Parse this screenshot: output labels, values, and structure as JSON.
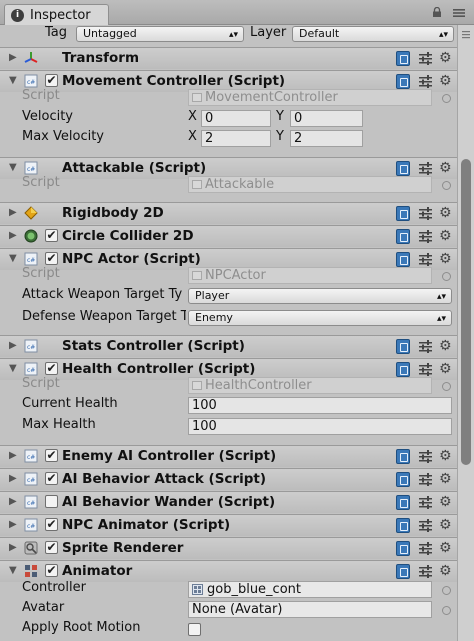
{
  "window": {
    "tab_label": "Inspector"
  },
  "topbar": {
    "tag_label": "Tag",
    "tag_value": "Untagged",
    "layer_label": "Layer",
    "layer_value": "Default"
  },
  "components": {
    "transform": {
      "title": "Transform"
    },
    "movement": {
      "title": "Movement Controller (Script)",
      "script_label": "Script",
      "script_value": "MovementController",
      "velocity_label": "Velocity",
      "velocity_x_label": "X",
      "velocity_x": "0",
      "velocity_y_label": "Y",
      "velocity_y": "0",
      "max_velocity_label": "Max Velocity",
      "max_x_label": "X",
      "max_x": "2",
      "max_y_label": "Y",
      "max_y": "2"
    },
    "attackable": {
      "title": "Attackable (Script)",
      "script_label": "Script",
      "script_value": "Attackable"
    },
    "rigidbody": {
      "title": "Rigidbody 2D"
    },
    "circle": {
      "title": "Circle Collider 2D"
    },
    "npc_actor": {
      "title": "NPC Actor (Script)",
      "script_label": "Script",
      "script_value": "NPCActor",
      "attack_label": "Attack Weapon Target Ty",
      "attack_value": "Player",
      "defense_label": "Defense Weapon Target T",
      "defense_value": "Enemy"
    },
    "stats": {
      "title": "Stats Controller (Script)"
    },
    "health": {
      "title": "Health Controller (Script)",
      "script_label": "Script",
      "script_value": "HealthController",
      "current_label": "Current Health",
      "current_value": "100",
      "max_label": "Max Health",
      "max_value": "100"
    },
    "enemy_ai": {
      "title": "Enemy AI Controller (Script)"
    },
    "ai_attack": {
      "title": "AI Behavior Attack (Script)"
    },
    "ai_wander": {
      "title": "AI Behavior Wander (Script)"
    },
    "npc_animator": {
      "title": "NPC Animator (Script)"
    },
    "sprite_renderer": {
      "title": "Sprite Renderer"
    },
    "animator": {
      "title": "Animator",
      "controller_label": "Controller",
      "controller_value": "gob_blue_cont",
      "avatar_label": "Avatar",
      "avatar_value": "None (Avatar)",
      "root_motion_label": "Apply Root Motion"
    }
  },
  "colors": {
    "accent": "#3a78b8",
    "panel": "#c2c2c2",
    "header": "#c4c4c4"
  }
}
